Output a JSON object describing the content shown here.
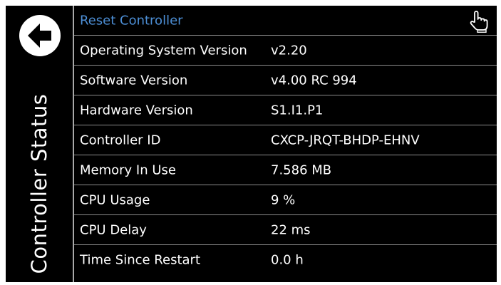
{
  "sidebar": {
    "title": "Controller Status",
    "back_icon": "back-arrow-icon"
  },
  "header": {
    "reset_label": "Reset Controller",
    "touch_icon": "hand-pointer-icon"
  },
  "rows": [
    {
      "label": "Operating System Version",
      "value": "v2.20"
    },
    {
      "label": "Software Version",
      "value": "v4.00 RC 994"
    },
    {
      "label": "Hardware Version",
      "value": "S1.I1.P1"
    },
    {
      "label": "Controller ID",
      "value": "CXCP-JRQT-BHDP-EHNV"
    },
    {
      "label": "Memory In Use",
      "value": "7.586 MB"
    },
    {
      "label": "CPU Usage",
      "value": "9 %"
    },
    {
      "label": "CPU Delay",
      "value": "22 ms"
    },
    {
      "label": "Time Since Restart",
      "value": "0.0 h"
    }
  ],
  "colors": {
    "background": "#000000",
    "text": "#ffffff",
    "link": "#4d8fd6",
    "divider": "#8c8c8c"
  }
}
